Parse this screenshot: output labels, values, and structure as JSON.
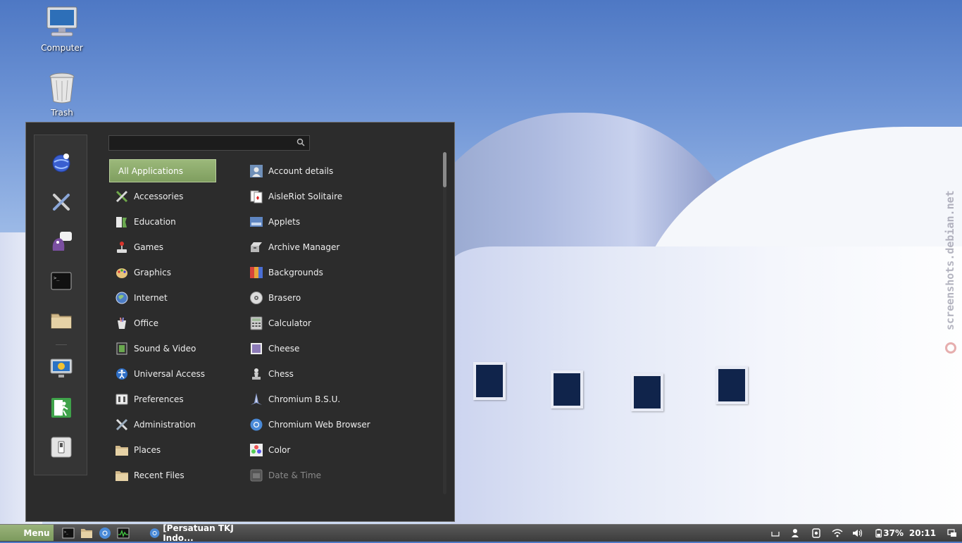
{
  "desktop": {
    "icons": [
      {
        "label": "Computer",
        "icon": "computer-icon"
      },
      {
        "label": "Trash",
        "icon": "trash-icon"
      }
    ],
    "watermark": "screenshots.debian.net"
  },
  "menu": {
    "search": {
      "value": "",
      "placeholder": ""
    },
    "favorites": [
      {
        "name": "web-browser-fav",
        "icon": "globe-icon"
      },
      {
        "name": "settings-fav",
        "icon": "tools-icon"
      },
      {
        "name": "messenger-fav",
        "icon": "pidgin-icon"
      },
      {
        "name": "terminal-fav",
        "icon": "terminal-icon"
      },
      {
        "name": "files-fav",
        "icon": "folder-icon"
      },
      {
        "name": "lock-screen-fav",
        "icon": "lock-screen-icon"
      },
      {
        "name": "logout-fav",
        "icon": "exit-icon"
      },
      {
        "name": "shutdown-fav",
        "icon": "power-icon"
      }
    ],
    "categories": [
      {
        "label": "All Applications",
        "active": true
      },
      {
        "label": "Accessories"
      },
      {
        "label": "Education"
      },
      {
        "label": "Games"
      },
      {
        "label": "Graphics"
      },
      {
        "label": "Internet"
      },
      {
        "label": "Office"
      },
      {
        "label": "Sound & Video"
      },
      {
        "label": "Universal Access"
      },
      {
        "label": "Preferences"
      },
      {
        "label": "Administration"
      },
      {
        "label": "Places"
      },
      {
        "label": "Recent Files"
      }
    ],
    "applications": [
      {
        "label": "Account details"
      },
      {
        "label": "AisleRiot Solitaire"
      },
      {
        "label": "Applets"
      },
      {
        "label": "Archive Manager"
      },
      {
        "label": "Backgrounds"
      },
      {
        "label": "Brasero"
      },
      {
        "label": "Calculator"
      },
      {
        "label": "Cheese"
      },
      {
        "label": "Chess"
      },
      {
        "label": "Chromium B.S.U."
      },
      {
        "label": "Chromium Web Browser"
      },
      {
        "label": "Color"
      },
      {
        "label": "Date & Time",
        "dim": true
      }
    ]
  },
  "taskbar": {
    "menu_label": "Menu",
    "window_title": "[Persatuan TKJ Indo...",
    "battery_text": "37%",
    "clock": "20:11"
  },
  "colors": {
    "accent": "#8cab6b",
    "panel_bg": "#2c2c2c",
    "taskbar_bg": "#4a4a4a"
  }
}
